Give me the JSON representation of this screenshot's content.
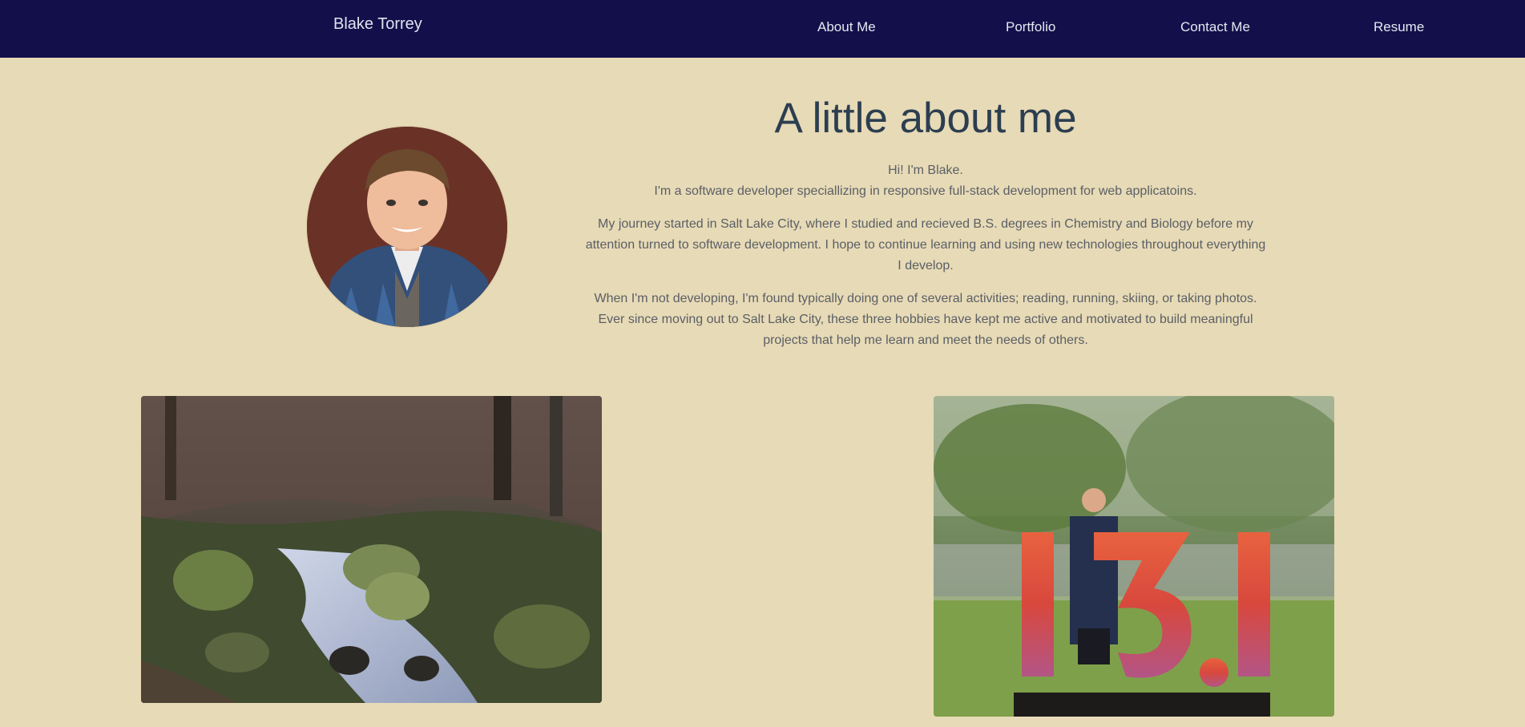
{
  "nav": {
    "brand": "Blake Torrey",
    "links": [
      "About Me",
      "Portfolio",
      "Contact Me",
      "Resume"
    ]
  },
  "about": {
    "heading": "A little about me",
    "intro_line1": "Hi! I'm Blake.",
    "intro_line2": "I'm a software developer speciallizing in responsive full-stack development for web applicatoins.",
    "paragraph1": "My journey started in Salt Lake City, where I studied and recieved B.S. degrees in Chemistry and Biology before my attention turned to software development. I hope to continue learning and using new technologies throughout everything I develop.",
    "paragraph2": "When I'm not developing, I'm found typically doing one of several activities; reading, running, skiing, or taking photos. Ever since moving out to Salt Lake City, these three hobbies have kept me active and motivated to build meaningful projects that help me learn and meet the needs of others."
  },
  "colors": {
    "navbar": "#130f4a",
    "background": "#e7dab6",
    "heading": "#2c3e50"
  }
}
